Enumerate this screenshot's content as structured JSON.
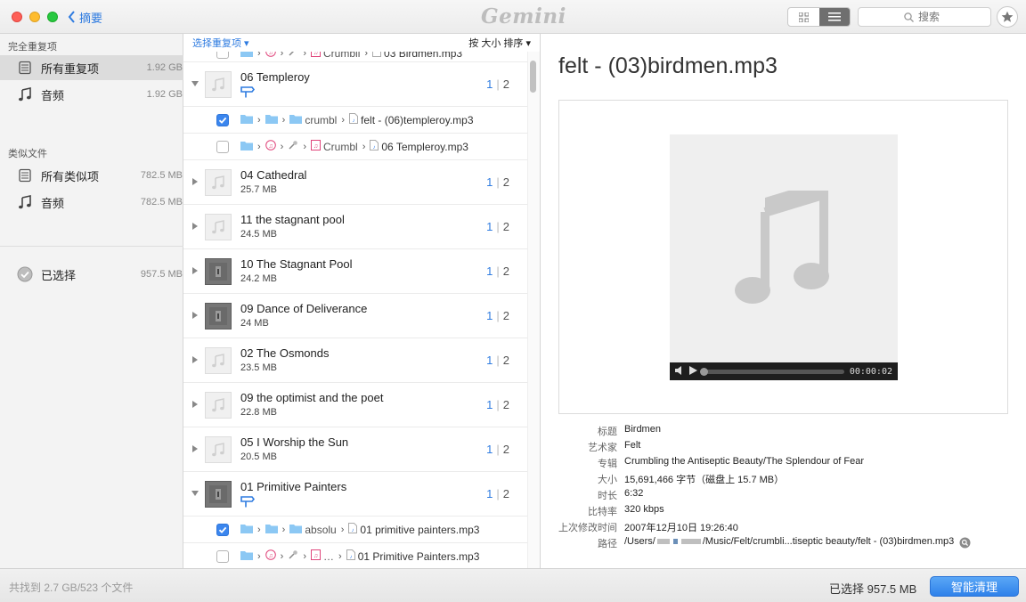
{
  "window": {
    "back_label": "摘要",
    "logo": "Gemini",
    "search_placeholder": "搜索"
  },
  "sidebar": {
    "section1": "完全重复项",
    "items1": [
      {
        "label": "所有重复项",
        "size": "1.92 GB",
        "icon": "stack-icon",
        "selected": true
      },
      {
        "label": "音频",
        "size": "1.92 GB",
        "icon": "music-note-icon"
      }
    ],
    "section2": "类似文件",
    "items2": [
      {
        "label": "所有类似项",
        "size": "782.5 MB",
        "icon": "stack-icon"
      },
      {
        "label": "音频",
        "size": "782.5 MB",
        "icon": "music-note-icon"
      }
    ],
    "selected_item": {
      "label": "已选择",
      "size": "957.5 MB",
      "icon": "check-circle-icon"
    }
  },
  "list": {
    "header_left": "选择重复项 ▾",
    "header_right": "按 大小 排序 ▾",
    "top_partial_row": {
      "seg1": "Crumbli",
      "file": "03 Birdmen.mp3"
    },
    "groups": [
      {
        "name": "06 Templeroy",
        "size": "",
        "count_selected": "1",
        "count_total": "2",
        "expanded": true,
        "children": [
          {
            "checked": true,
            "folder": "crumbl",
            "file": "felt - (06)templeroy.mp3"
          },
          {
            "checked": false,
            "folder": "Crumbl",
            "file": "06 Templeroy.mp3"
          }
        ]
      },
      {
        "name": "04 Cathedral",
        "size": "25.7 MB",
        "count_selected": "1",
        "count_total": "2"
      },
      {
        "name": "11 the stagnant pool",
        "size": "24.5 MB",
        "count_selected": "1",
        "count_total": "2"
      },
      {
        "name": "10 The Stagnant Pool",
        "size": "24.2 MB",
        "count_selected": "1",
        "count_total": "2"
      },
      {
        "name": "09 Dance of Deliverance",
        "size": "24 MB",
        "count_selected": "1",
        "count_total": "2"
      },
      {
        "name": "02 The Osmonds",
        "size": "23.5 MB",
        "count_selected": "1",
        "count_total": "2"
      },
      {
        "name": "09 the optimist and the poet",
        "size": "22.8 MB",
        "count_selected": "1",
        "count_total": "2"
      },
      {
        "name": "05 I Worship the Sun",
        "size": "20.5 MB",
        "count_selected": "1",
        "count_total": "2"
      },
      {
        "name": "01 Primitive Painters",
        "size": "",
        "count_selected": "1",
        "count_total": "2",
        "expanded": true,
        "children": [
          {
            "checked": true,
            "folder": "absolu",
            "file": "01 primitive painters.mp3"
          },
          {
            "checked": false,
            "folder": "",
            "file": "01 Primitive Painters.mp3"
          }
        ]
      }
    ]
  },
  "detail": {
    "title": "felt - (03)birdmen.mp3",
    "player_time": "00:00:02",
    "meta": [
      {
        "key": "标题",
        "value": "Birdmen"
      },
      {
        "key": "艺术家",
        "value": "Felt"
      },
      {
        "key": "专辑",
        "value": "Crumbling the Antiseptic Beauty/The Splendour of Fear"
      },
      {
        "key": "大小",
        "value": "15,691,466 字节（磁盘上 15.7 MB）"
      },
      {
        "key": "时长",
        "value": "6:32"
      },
      {
        "key": "比特率",
        "value": "320 kbps"
      },
      {
        "key": "上次修改时间",
        "value": "2007年12月10日 19:26:40"
      },
      {
        "key": "路径",
        "value_prefix": "/Users/",
        "value_suffix": "/Music/Felt/crumbli...tiseptic beauty/felt - (03)birdmen.mp3"
      }
    ]
  },
  "bottom": {
    "found": "共找到 2.7 GB/523 个文件",
    "selected": "已选择 957.5 MB",
    "clean_button": "智能清理"
  },
  "colors": {
    "accent": "#2e7be0",
    "button": "#3b86ee",
    "sidebar_bg": "#f3f3f3"
  }
}
